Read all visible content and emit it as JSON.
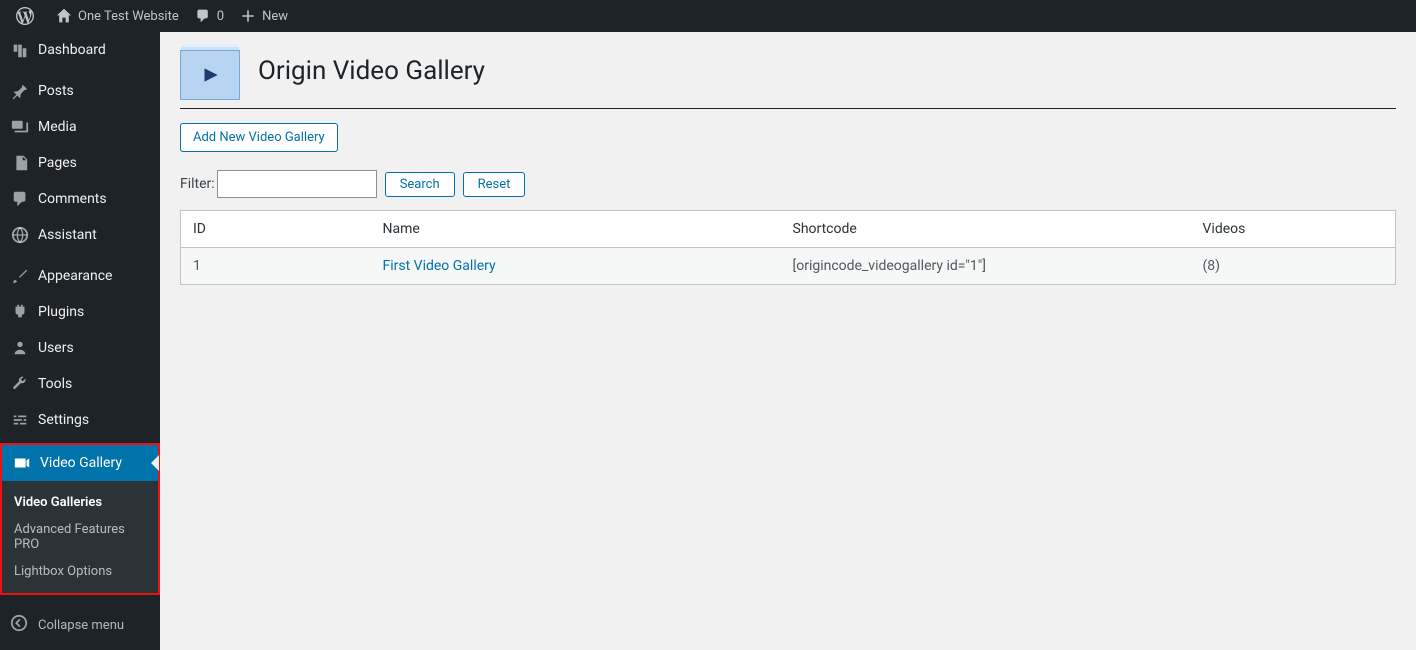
{
  "adminBar": {
    "siteName": "One Test Website",
    "commentCount": "0",
    "newLabel": "New"
  },
  "sidebar": {
    "items": [
      {
        "label": "Dashboard"
      },
      {
        "label": "Posts"
      },
      {
        "label": "Media"
      },
      {
        "label": "Pages"
      },
      {
        "label": "Comments"
      },
      {
        "label": "Assistant"
      },
      {
        "label": "Appearance"
      },
      {
        "label": "Plugins"
      },
      {
        "label": "Users"
      },
      {
        "label": "Tools"
      },
      {
        "label": "Settings"
      },
      {
        "label": "Video Gallery"
      }
    ],
    "submenu": [
      {
        "label": "Video Galleries"
      },
      {
        "label": "Advanced Features PRO"
      },
      {
        "label": "Lightbox Options"
      }
    ],
    "collapseLabel": "Collapse menu"
  },
  "main": {
    "heading": "Origin Video Gallery",
    "addNewLabel": "Add New Video Gallery",
    "filterLabel": "Filter:",
    "searchLabel": "Search",
    "resetLabel": "Reset",
    "columns": {
      "id": "ID",
      "name": "Name",
      "shortcode": "Shortcode",
      "videos": "Videos"
    },
    "rows": [
      {
        "id": "1",
        "name": "First Video Gallery",
        "shortcode": "[origincode_videogallery id=\"1\"]",
        "videos": "(8)"
      }
    ]
  }
}
